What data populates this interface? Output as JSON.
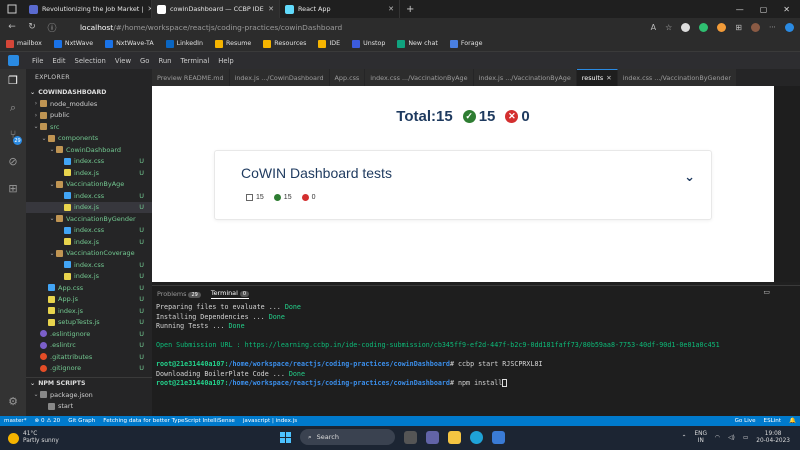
{
  "browser": {
    "tabs": [
      {
        "label": "Revolutionizing the Job Market |",
        "favicon_color": "#5a6acf",
        "active": false
      },
      {
        "label": "cowinDashboard — CCBP IDE",
        "favicon_color": "#ffffff",
        "active": true
      },
      {
        "label": "React App",
        "favicon_color": "#61dafb",
        "active": false
      }
    ],
    "new_tab": "+",
    "url_host": "localhost",
    "url_path": "/#/home/workspace/reactjs/coding-practices/cowinDashboard",
    "bookmarks": [
      {
        "label": "mailbox",
        "color": "#d44638"
      },
      {
        "label": "NxtWave",
        "color": "#1a73e8"
      },
      {
        "label": "NxtWave-TA",
        "color": "#1a73e8"
      },
      {
        "label": "LinkedIn",
        "color": "#0a66c2"
      },
      {
        "label": "Resume",
        "color": "#f5b400"
      },
      {
        "label": "Resources",
        "color": "#f5b400"
      },
      {
        "label": "IDE",
        "color": "#f5b400"
      },
      {
        "label": "Unstop",
        "color": "#3c5cde"
      },
      {
        "label": "New chat",
        "color": "#10a37f"
      },
      {
        "label": "Forage",
        "color": "#4a7fe0"
      }
    ]
  },
  "vscode": {
    "menu": [
      "File",
      "Edit",
      "Selection",
      "View",
      "Go",
      "Run",
      "Terminal",
      "Help"
    ],
    "scm_badge": "29",
    "explorer_title": "EXPLORER",
    "root": "COWINDASHBOARD",
    "tree": [
      {
        "label": "node_modules",
        "depth": 0,
        "chev": "›",
        "icon": "folder",
        "status": ""
      },
      {
        "label": "public",
        "depth": 0,
        "chev": "›",
        "icon": "folder",
        "status": ""
      },
      {
        "label": "src",
        "depth": 0,
        "chev": "⌄",
        "icon": "folder",
        "status": "",
        "green": true
      },
      {
        "label": "components",
        "depth": 1,
        "chev": "⌄",
        "icon": "folder",
        "status": "",
        "green": true
      },
      {
        "label": "CowinDashboard",
        "depth": 2,
        "chev": "⌄",
        "icon": "folder",
        "status": "",
        "green": true
      },
      {
        "label": "index.css",
        "depth": 3,
        "chev": "",
        "icon": "css",
        "status": "U",
        "green": true
      },
      {
        "label": "index.js",
        "depth": 3,
        "chev": "",
        "icon": "js",
        "status": "U",
        "green": true
      },
      {
        "label": "VaccinationByAge",
        "depth": 2,
        "chev": "⌄",
        "icon": "folder",
        "status": "",
        "green": true
      },
      {
        "label": "index.css",
        "depth": 3,
        "chev": "",
        "icon": "css",
        "status": "U",
        "green": true
      },
      {
        "label": "index.js",
        "depth": 3,
        "chev": "",
        "icon": "js",
        "status": "U",
        "green": true,
        "selected": true
      },
      {
        "label": "VaccinationByGender",
        "depth": 2,
        "chev": "⌄",
        "icon": "folder",
        "status": "",
        "green": true
      },
      {
        "label": "index.css",
        "depth": 3,
        "chev": "",
        "icon": "css",
        "status": "U",
        "green": true
      },
      {
        "label": "index.js",
        "depth": 3,
        "chev": "",
        "icon": "js",
        "status": "U",
        "green": true
      },
      {
        "label": "VaccinationCoverage",
        "depth": 2,
        "chev": "⌄",
        "icon": "folder",
        "status": "",
        "green": true
      },
      {
        "label": "index.css",
        "depth": 3,
        "chev": "",
        "icon": "css",
        "status": "U",
        "green": true
      },
      {
        "label": "index.js",
        "depth": 3,
        "chev": "",
        "icon": "js",
        "status": "U",
        "green": true
      },
      {
        "label": "App.css",
        "depth": 1,
        "chev": "",
        "icon": "css",
        "status": "U",
        "green": true
      },
      {
        "label": "App.js",
        "depth": 1,
        "chev": "",
        "icon": "js",
        "status": "U",
        "green": true
      },
      {
        "label": "index.js",
        "depth": 1,
        "chev": "",
        "icon": "js",
        "status": "U",
        "green": true
      },
      {
        "label": "setupTests.js",
        "depth": 1,
        "chev": "",
        "icon": "js",
        "status": "U",
        "green": true
      },
      {
        "label": ".eslintignore",
        "depth": 0,
        "chev": "",
        "icon": "lint",
        "status": "U",
        "green": true
      },
      {
        "label": ".eslintrc",
        "depth": 0,
        "chev": "",
        "icon": "lint",
        "status": "U",
        "green": true
      },
      {
        "label": ".gitattributes",
        "depth": 0,
        "chev": "",
        "icon": "git",
        "status": "U",
        "green": true
      },
      {
        "label": ".gitignore",
        "depth": 0,
        "chev": "",
        "icon": "git",
        "status": "U",
        "green": true
      }
    ],
    "npm_scripts_title": "NPM SCRIPTS",
    "npm_items": [
      {
        "label": "package.json",
        "depth": 0,
        "chev": "⌄"
      },
      {
        "label": "start",
        "depth": 1,
        "chev": ""
      }
    ],
    "editor_tabs": [
      {
        "label": "Preview README.md",
        "active": false
      },
      {
        "label": "index.js .../CowinDashboard",
        "active": false
      },
      {
        "label": "App.css",
        "active": false
      },
      {
        "label": "index.css .../VaccinationByAge",
        "active": false
      },
      {
        "label": "index.js .../VaccinationByAge",
        "active": false
      },
      {
        "label": "results",
        "active": true
      },
      {
        "label": "index.css .../VaccinationByGender",
        "active": false
      }
    ],
    "preview": {
      "total_label": "Total:15",
      "passed": "15",
      "failed": "0",
      "card_title": "CoWIN Dashboard tests",
      "card_total": "15",
      "card_passed": "15",
      "card_failed": "0"
    },
    "panel": {
      "tabs": [
        {
          "label": "Problems",
          "badge": "29",
          "active": false
        },
        {
          "label": "Terminal",
          "badge": "0",
          "active": true
        }
      ],
      "lines": [
        {
          "text": "Preparing files to evaluate ... ",
          "tail": "Done"
        },
        {
          "text": "Installing Dependencies ... ",
          "tail": "Done"
        },
        {
          "text": "Running Tests ... ",
          "tail": "Done"
        }
      ],
      "submission_label": "Open Submission URL : https://learning.ccbp.in/ide-coding-submission/cb345ff9-ef2d-447f-b2c9-0dd181faff73/80b59aa8-7753-40df-90d1-0e01a0c451",
      "prompt1_user": "root@21e31440a107:",
      "prompt1_path": "/home/workspace/reactjs/coding-practices/cowinDashboard",
      "prompt1_cmd": "# ccbp start RJSCPRXL8I",
      "downloading": "Downloading BoilerPlate Code ... ",
      "downloading_tail": "Done",
      "prompt2_user": "root@21e31440a107:",
      "prompt2_path": "/home/workspace/reactjs/coding-practices/cowinDashboard",
      "prompt2_cmd": "# npm install"
    },
    "statusbar": {
      "left": [
        "master*",
        "⊗ 0 ⚠ 20",
        "Git Graph",
        "Fetching data for better TypeScript IntelliSense",
        "javascript | index.js"
      ],
      "right": [
        "Go Live",
        "ESLint",
        "🔔"
      ]
    }
  },
  "taskbar": {
    "temp": "41°C",
    "weather": "Partly sunny",
    "search_placeholder": "Search",
    "lang1": "ENG",
    "lang2": "IN",
    "time": "19:08",
    "date": "20-04-2023"
  }
}
